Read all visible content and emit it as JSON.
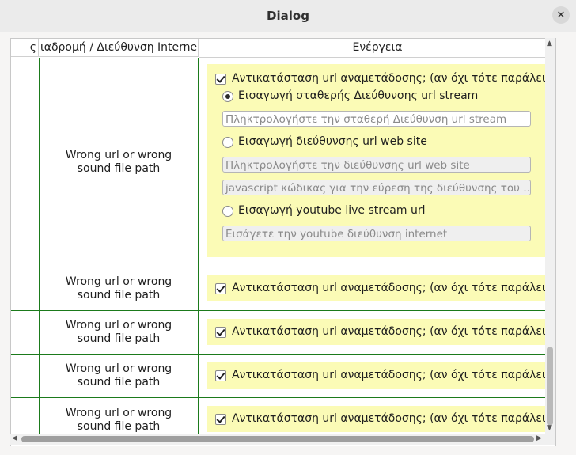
{
  "window": {
    "title": "Dialog",
    "close_glyph": "✕"
  },
  "table": {
    "headers": [
      "ς",
      "ιαδρομή / Διεύθυνση Interne",
      "Ενέργεια"
    ],
    "rows": [
      {
        "path": "Wrong url or wrong sound file path",
        "replace_label": "Αντικατάσταση url αναμετάδοσης; (αν όχι τότε παράλειψη)",
        "replace_checked": true,
        "expanded": true,
        "options": {
          "fixed_label": "Εισαγωγή σταθερής Διεύθυνσης url stream",
          "fixed_placeholder": "Πληκτρολογήστε την σταθερή Διεύθυνση url stream",
          "website_label": "Εισαγωγή διεύθυνσης url web site",
          "website_placeholder": "Πληκτρολογήστε την διεύθυνσης url web site",
          "javascript_placeholder": "javascript κώδικας για την εύρεση της διεύθυνσης του …",
          "youtube_label": "Εισαγωγή youtube live stream url",
          "youtube_placeholder": "Εισάγετε την youtube διεύθυνση internet",
          "selected": "fixed"
        }
      },
      {
        "path": "Wrong url or wrong sound file path",
        "replace_label": "Αντικατάσταση url αναμετάδοσης; (αν όχι τότε παράλειψη)",
        "replace_checked": true,
        "expanded": false
      },
      {
        "path": "Wrong url or wrong sound file path",
        "replace_label": "Αντικατάσταση url αναμετάδοσης; (αν όχι τότε παράλειψη)",
        "replace_checked": true,
        "expanded": false
      },
      {
        "path": "Wrong url or wrong sound file path",
        "replace_label": "Αντικατάσταση url αναμετάδοσης; (αν όχι τότε παράλειψη)",
        "replace_checked": true,
        "expanded": false
      },
      {
        "path": "Wrong url or wrong sound file path",
        "replace_label": "Αντικατάσταση url αναμετάδοσης; (αν όχι τότε παράλειψη)",
        "replace_checked": true,
        "expanded": false
      }
    ]
  },
  "colors": {
    "row_border": "#1b7a1b",
    "action_panel": "#fbfbb6"
  },
  "icons": {
    "close": "close-icon",
    "check": "check-icon",
    "radio": "radio-icon",
    "scroll_up": "arrow-up-icon",
    "scroll_down": "arrow-down-icon",
    "scroll_left": "arrow-left-icon",
    "scroll_right": "arrow-right-icon"
  }
}
